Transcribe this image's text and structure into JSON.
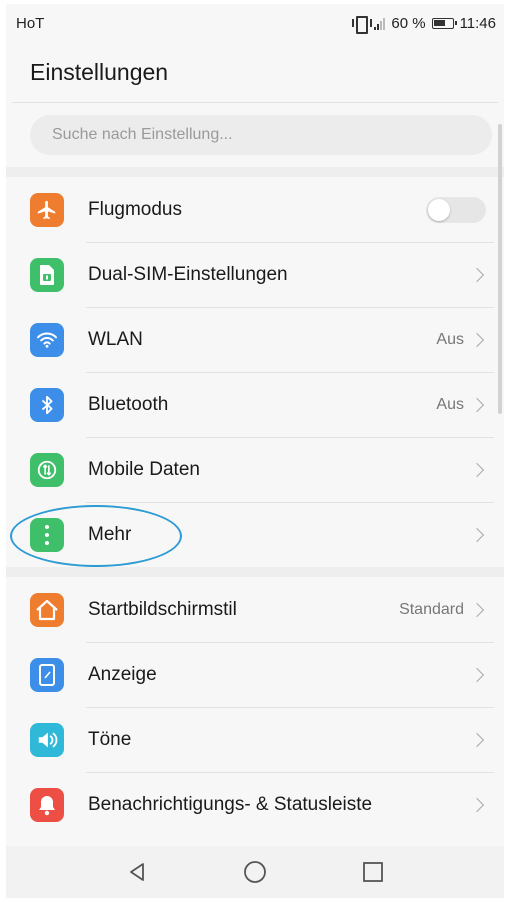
{
  "status_bar": {
    "carrier": "HoT",
    "battery_percent": "60 %",
    "time": "11:46"
  },
  "header": {
    "title": "Einstellungen"
  },
  "search": {
    "placeholder": "Suche nach Einstellung..."
  },
  "sections": [
    {
      "items": [
        {
          "label": "Flugmodus",
          "icon": "airplane-icon",
          "color": "#ef7d2f",
          "toggle": "off"
        },
        {
          "label": "Dual-SIM-Einstellungen",
          "icon": "sim-card-icon",
          "color": "#3fbf6a"
        },
        {
          "label": "WLAN",
          "icon": "wifi-icon",
          "color": "#3d8ee8",
          "value": "Aus"
        },
        {
          "label": "Bluetooth",
          "icon": "bluetooth-icon",
          "color": "#3d8ee8",
          "value": "Aus"
        },
        {
          "label": "Mobile Daten",
          "icon": "mobile-data-icon",
          "color": "#3fbf6a"
        },
        {
          "label": "Mehr",
          "icon": "more-dots-icon",
          "color": "#3fbf6a",
          "highlighted": true
        }
      ]
    },
    {
      "items": [
        {
          "label": "Startbildschirmstil",
          "icon": "home-icon",
          "color": "#ef7d2f",
          "value": "Standard"
        },
        {
          "label": "Anzeige",
          "icon": "display-icon",
          "color": "#3d8ee8"
        },
        {
          "label": "Töne",
          "icon": "speaker-icon",
          "color": "#2fb8d8"
        },
        {
          "label": "Benachrichtigungs- & Statusleiste",
          "icon": "bell-icon",
          "color": "#ee4f45"
        }
      ]
    }
  ],
  "colors": {
    "highlight": "#2e9bd3",
    "background": "#f7f7f7"
  }
}
